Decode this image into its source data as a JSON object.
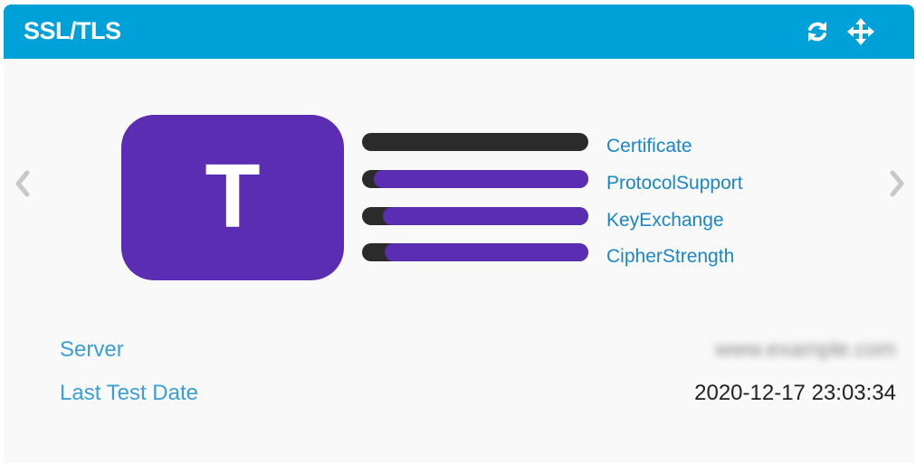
{
  "widget": {
    "title": "SSL/TLS",
    "icons": {
      "refresh": "refresh-icon",
      "move": "move-icon"
    },
    "colors": {
      "header": "#00a0d9",
      "grade": "#5b2db3",
      "bar_track": "#2b2b2b",
      "label": "#1a86c7"
    }
  },
  "grade": {
    "letter": "T",
    "categories": [
      {
        "label": "Certificate",
        "score": 0
      },
      {
        "label": "ProtocolSupport",
        "score": 0.95
      },
      {
        "label": "KeyExchange",
        "score": 0.91
      },
      {
        "label": "CipherStrength",
        "score": 0.9
      }
    ]
  },
  "details": {
    "server_label": "Server",
    "server_value": "www.example.com",
    "date_label": "Last Test Date",
    "date_value": "2020-12-17 23:03:34"
  },
  "navigation": {
    "prev_icon": "chevron-left-icon",
    "next_icon": "chevron-right-icon"
  }
}
